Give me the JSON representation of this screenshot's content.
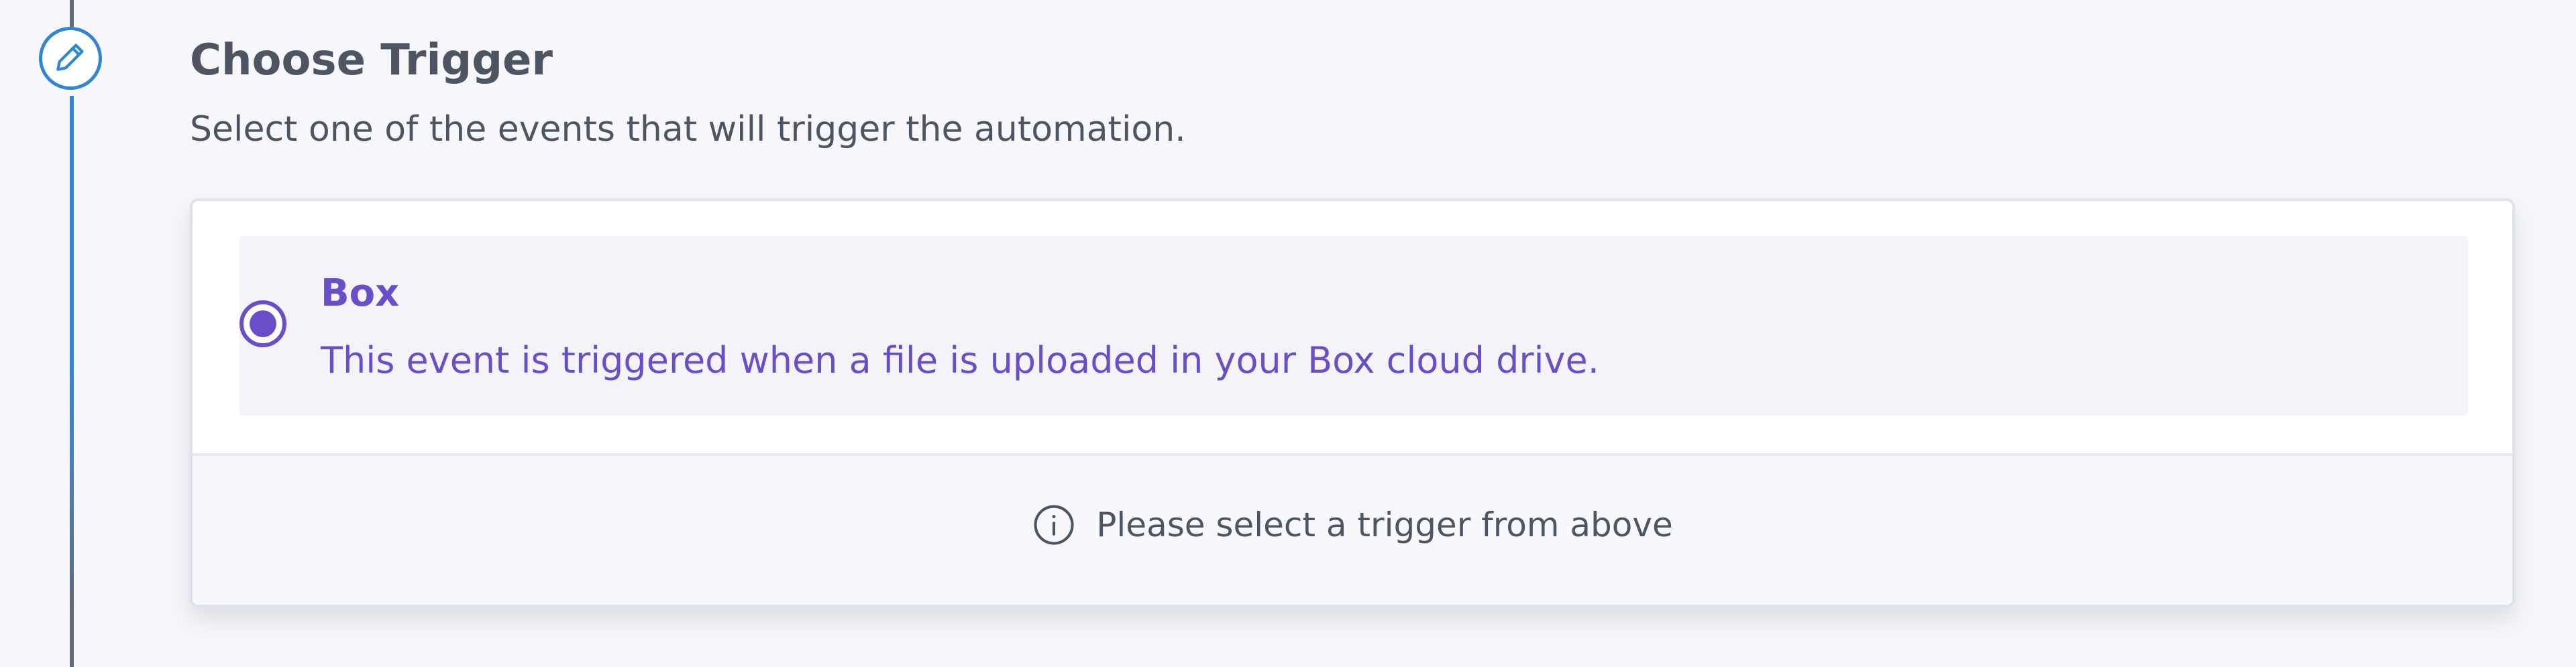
{
  "step": {
    "icon": "pencil-icon",
    "title": "Choose Trigger",
    "description": "Select one of the events that will trigger the automation."
  },
  "trigger_options": [
    {
      "title": "Box",
      "description": "This event is triggered when a file is uploaded in your Box cloud drive.",
      "selected": true
    }
  ],
  "footer": {
    "icon": "info-icon",
    "message": "Please select a trigger from above"
  },
  "colors": {
    "accent": "#6a4ec8",
    "timeline": "#2f86d6",
    "text": "#4d5563"
  }
}
